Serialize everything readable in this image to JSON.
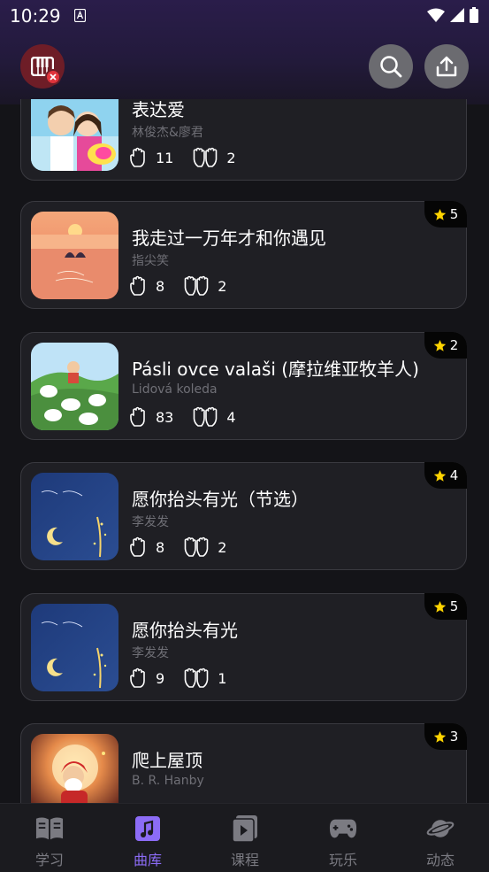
{
  "status_bar": {
    "time": "10:29"
  },
  "songs": [
    {
      "title": "表达爱",
      "artist": "林俊杰&廖君",
      "plays": "11",
      "duets": "2",
      "stars": ""
    },
    {
      "title": "我走过一万年才和你遇见",
      "artist": "指尖笑",
      "plays": "8",
      "duets": "2",
      "stars": "5"
    },
    {
      "title": "Pásli ovce valaši (摩拉维亚牧羊人)",
      "artist": "Lidová koleda",
      "plays": "83",
      "duets": "4",
      "stars": "2"
    },
    {
      "title": "愿你抬头有光（节选）",
      "artist": "李发发",
      "plays": "8",
      "duets": "2",
      "stars": "4"
    },
    {
      "title": "愿你抬头有光",
      "artist": "李发发",
      "plays": "9",
      "duets": "1",
      "stars": "5"
    },
    {
      "title": "爬上屋顶",
      "artist": "B. R. Hanby",
      "plays": "",
      "duets": "",
      "stars": "3"
    }
  ],
  "nav": [
    {
      "label": "学习",
      "icon": "book-icon",
      "active": false
    },
    {
      "label": "曲库",
      "icon": "music-library-icon",
      "active": true
    },
    {
      "label": "课程",
      "icon": "video-course-icon",
      "active": false
    },
    {
      "label": "玩乐",
      "icon": "gamepad-icon",
      "active": false
    },
    {
      "label": "动态",
      "icon": "planet-icon",
      "active": false
    }
  ],
  "colors": {
    "accent": "#8c6cf6",
    "star": "#ffd400",
    "danger": "#e0343c"
  }
}
